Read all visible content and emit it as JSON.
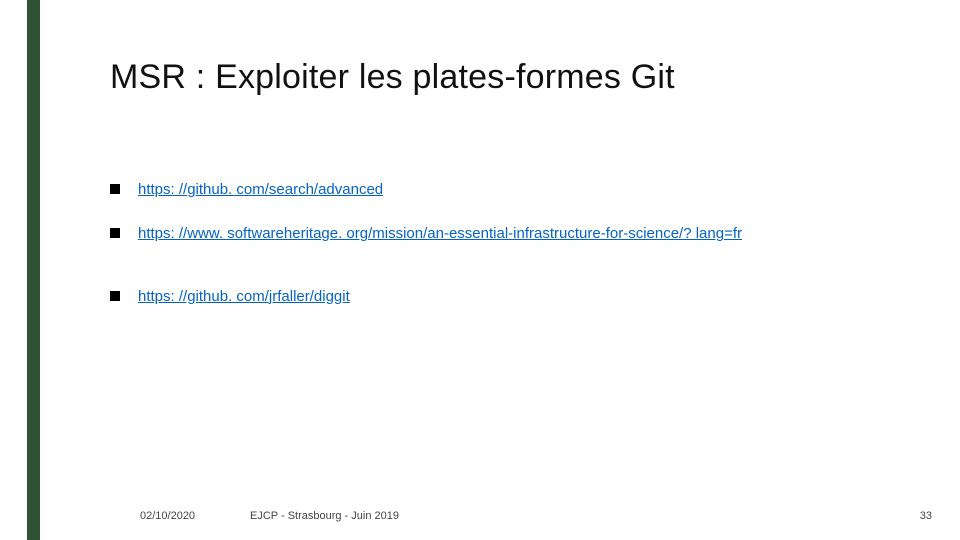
{
  "title": "MSR : Exploiter les plates-formes Git",
  "links": [
    "https: //github. com/search/advanced",
    "https: //www. softwareheritage. org/mission/an-essential-infrastructure-for-science/? lang=fr",
    "https: //github. com/jrfaller/diggit"
  ],
  "footer": {
    "date": "02/10/2020",
    "center": "EJCP - Strasbourg - Juin 2019",
    "page": "33"
  }
}
